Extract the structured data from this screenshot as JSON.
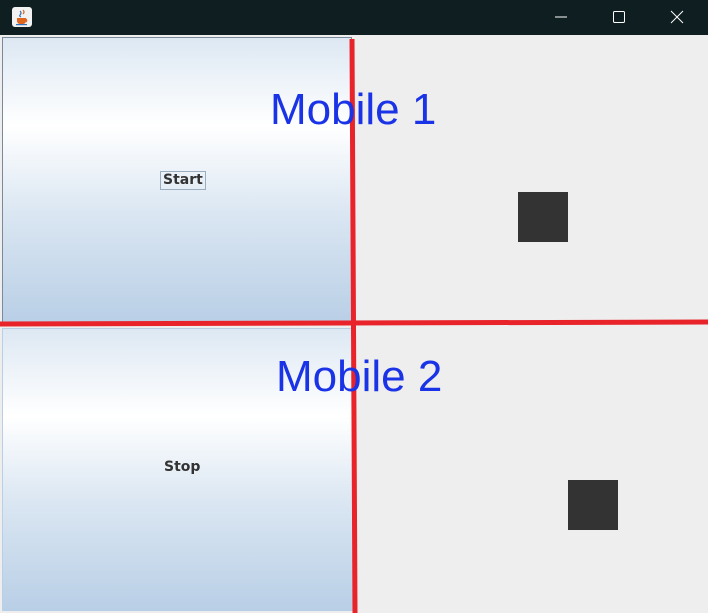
{
  "window": {
    "app_icon": "java-cup-icon",
    "controls": {
      "minimize_icon": "minimize-icon",
      "maximize_icon": "maximize-icon",
      "close_icon": "close-icon"
    }
  },
  "panel_top": {
    "button_label": "Start",
    "box_color": "#333333"
  },
  "panel_bottom": {
    "button_label": "Stop",
    "box_color": "#333333"
  },
  "annotations": {
    "label_1": "Mobile 1",
    "label_2": "Mobile 2",
    "line_color": "#e8232a",
    "text_color": "#1a33e6"
  }
}
